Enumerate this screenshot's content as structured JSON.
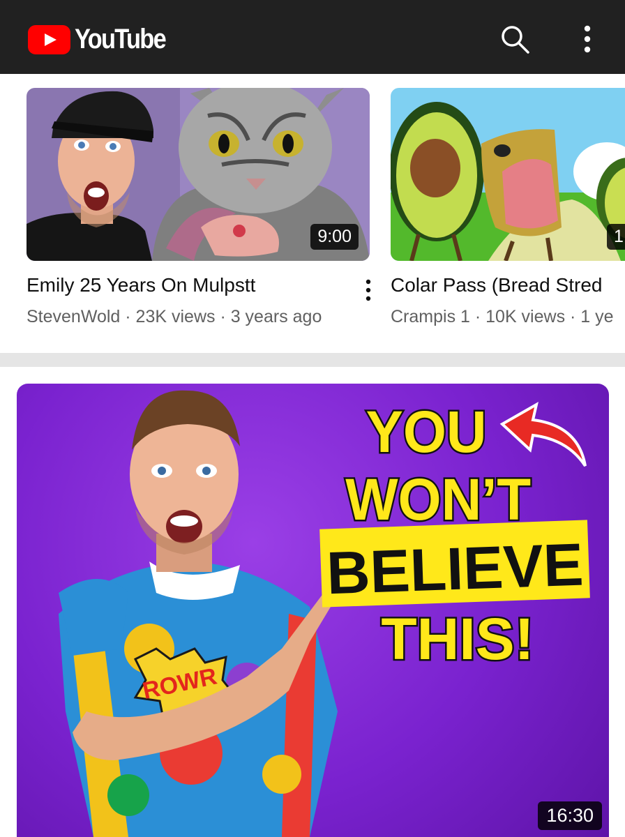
{
  "app": {
    "name": "YouTube"
  },
  "header": {
    "search_icon": "search-icon",
    "menu_icon": "more-vert-icon"
  },
  "shelf": {
    "videos": [
      {
        "title": "Emily 25 Years On Mulpstt",
        "channel": "StevenWold",
        "views": "23K views",
        "age": "3 years ago",
        "meta": "StevenWold · 23K views · 3 years ago",
        "duration": "9:00"
      },
      {
        "title": "Colar Pass (Bread Stred",
        "channel": "Crampis 1",
        "views": "10K views",
        "age": "1 ye",
        "meta": "Crampis 1 · 10K views · 1 ye",
        "duration": "1:"
      }
    ]
  },
  "feature": {
    "headline": [
      "YOU",
      "WON’T",
      "BELIEVE",
      "THIS!"
    ],
    "shirt_text": "ROWR",
    "duration": "16:30"
  },
  "colors": {
    "brand_red": "#ff0000",
    "header_bg": "#212121",
    "thumb_purple": "#7a22cf",
    "headline_yellow": "#ffe81a"
  }
}
